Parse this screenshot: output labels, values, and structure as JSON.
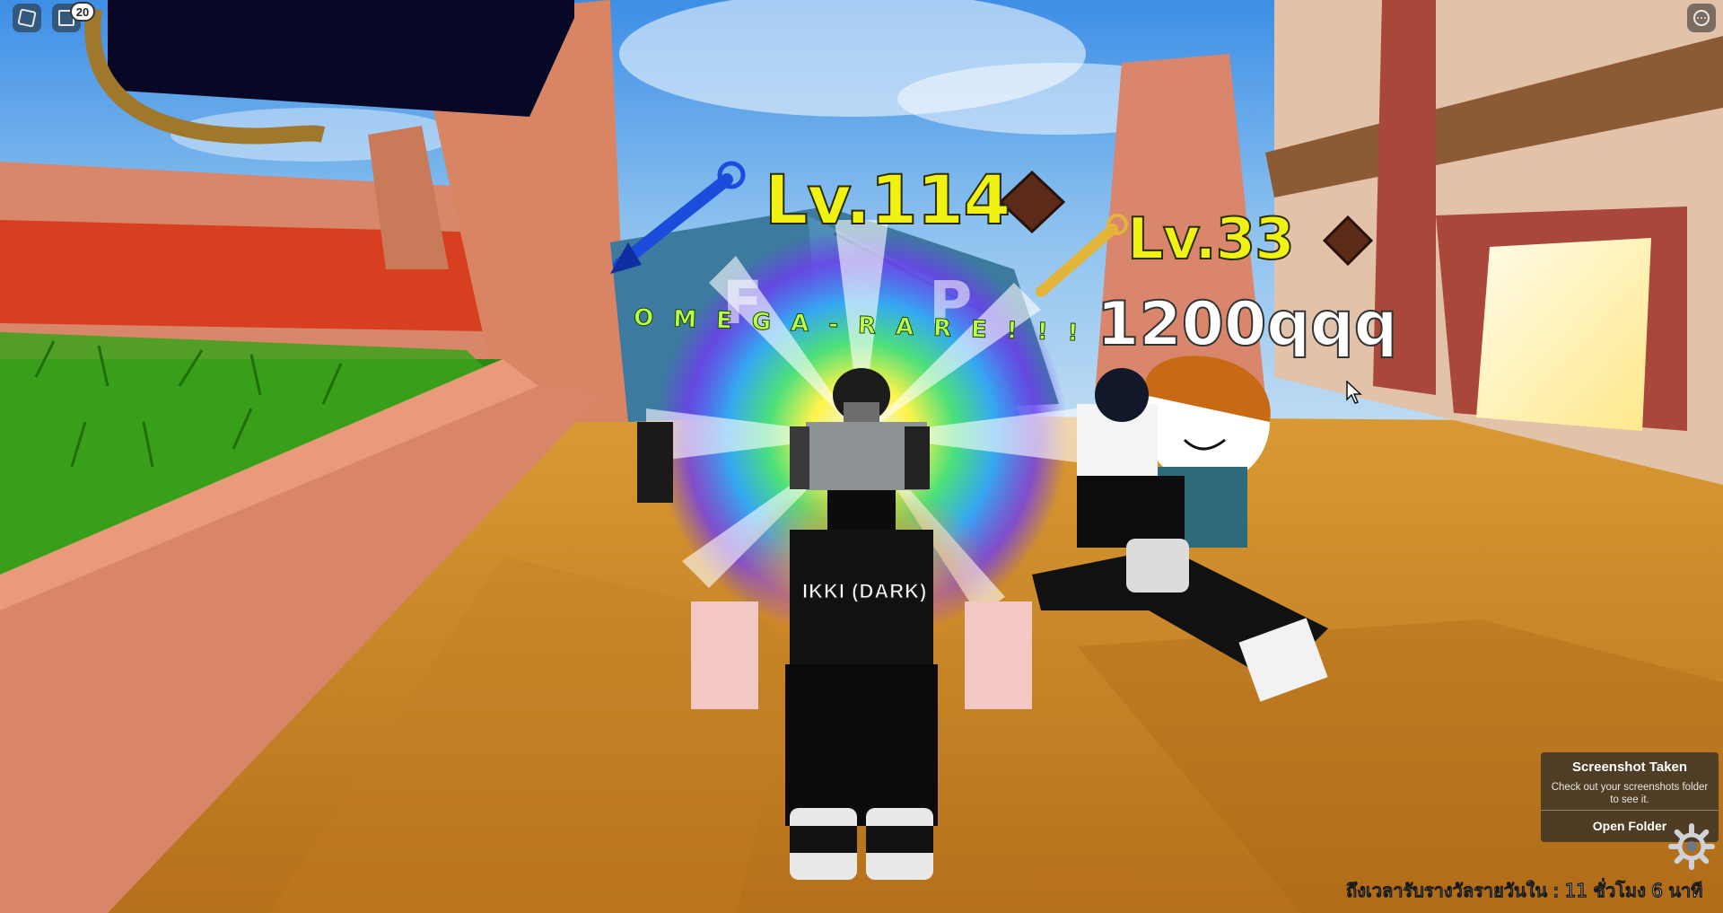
{
  "hud": {
    "notification_count": "20",
    "roblox_menu_icon": "roblox-logo-icon",
    "chat_icon": "chat-icon",
    "more_menu_icon": "more-options-icon"
  },
  "overhead": {
    "player1_level": "Lv.114",
    "player1_weapon_icon": "blue-kunai-icon",
    "player2_level": "Lv.33",
    "player2_weapon_icon": "gold-kunai-icon",
    "player2_value": "1200qqq",
    "rank_icon": "diamond-rank-icon",
    "rarity_text": "OMEGA-RARE!!!",
    "unit_name": "IKKI (DARK)"
  },
  "toast": {
    "title": "Screenshot Taken",
    "body": "Check out your screenshots folder to see it.",
    "button_label": "Open Folder"
  },
  "settings_icon": "gear-icon",
  "daily_reward_text": "ถึงเวลารับรางวัลรายวันใน : 11 ชั่วโมง 6 นาที",
  "colors": {
    "level_text": "#f0f213",
    "rarity_text": "#b8ff4a",
    "sky": "#5fa3e6",
    "ground": "#c9821f"
  }
}
